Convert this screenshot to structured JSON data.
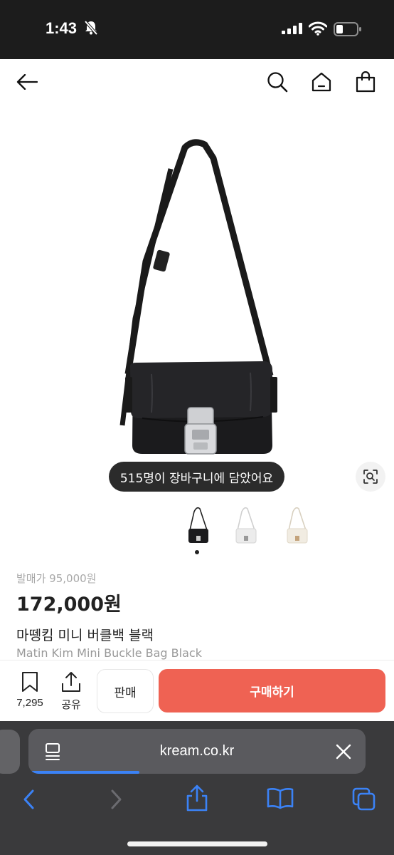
{
  "status_bar": {
    "time": "1:43"
  },
  "product": {
    "cart_notice": "515명이 장바구니에 담았어요",
    "release_price": "발매가 95,000원",
    "price": "172,000원",
    "name_ko": "마뗑킴 미니 버클백 블랙",
    "name_en": "Matin Kim Mini Buckle Bag Black",
    "thumbnail_variants": [
      "black",
      "white",
      "ivory"
    ],
    "selected_thumbnail": 0
  },
  "bottom_bar": {
    "bookmark_count": "7,295",
    "share_label": "공유",
    "sell_label": "판매",
    "buy_label": "구매하기"
  },
  "browser": {
    "url": "kream.co.kr"
  },
  "colors": {
    "buy_button": "#ef6253",
    "pill_bg": "#2b2b2b",
    "status_bar_bg": "#1c1c1c",
    "safari_bg": "#3a3a3c",
    "accent_blue": "#3b82f6"
  }
}
